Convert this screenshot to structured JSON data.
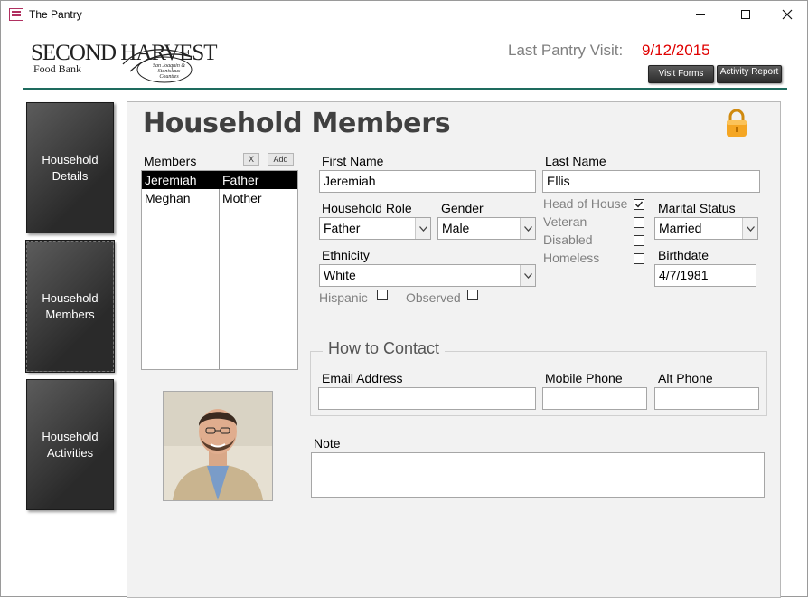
{
  "window": {
    "title": "The Pantry"
  },
  "header": {
    "logo_main": "SECOND HARVEST",
    "logo_sub": "Food Bank",
    "logo_small": "San Joaquin & Stanislaus Counties",
    "last_visit_label": "Last Pantry Visit:",
    "last_visit_date": "9/12/2015",
    "visit_forms_label": "Visit Forms",
    "activity_report_label": "Activity Report"
  },
  "sidebar": {
    "items": [
      {
        "label": "Household Details"
      },
      {
        "label": "Household Members"
      },
      {
        "label": "Household Activities"
      }
    ]
  },
  "panel": {
    "title": "Household Members",
    "members_label": "Members",
    "remove_button": "X",
    "add_button": "Add",
    "members": [
      {
        "name": "Jeremiah",
        "role": "Father",
        "selected": true
      },
      {
        "name": "Meghan",
        "role": "Mother",
        "selected": false
      }
    ]
  },
  "form": {
    "first_name_label": "First Name",
    "first_name": "Jeremiah",
    "last_name_label": "Last Name",
    "last_name": "Ellis",
    "household_role_label": "Household Role",
    "household_role": "Father",
    "gender_label": "Gender",
    "gender": "Male",
    "ethnicity_label": "Ethnicity",
    "ethnicity": "White",
    "hispanic_label": "Hispanic",
    "hispanic_checked": false,
    "observed_label": "Observed",
    "observed_checked": false,
    "head_of_house_label": "Head of House",
    "head_of_house_checked": true,
    "veteran_label": "Veteran",
    "veteran_checked": false,
    "disabled_label": "Disabled",
    "disabled_checked": false,
    "homeless_label": "Homeless",
    "homeless_checked": false,
    "marital_status_label": "Marital Status",
    "marital_status": "Married",
    "birthdate_label": "Birthdate",
    "birthdate": "4/7/1981"
  },
  "contact": {
    "section_title": "How to Contact",
    "email_label": "Email Address",
    "email": "",
    "mobile_label": "Mobile Phone",
    "mobile": "",
    "alt_phone_label": "Alt Phone",
    "alt_phone": ""
  },
  "note": {
    "label": "Note",
    "value": ""
  },
  "icons": {
    "lock": "lock-icon",
    "app": "access-form-icon",
    "dropdown": "chevron-down-icon",
    "check": "checkmark-icon"
  },
  "colors": {
    "accent_rule": "#1e6b5e",
    "visit_date": "#e00000",
    "lock": "#f0a020"
  }
}
